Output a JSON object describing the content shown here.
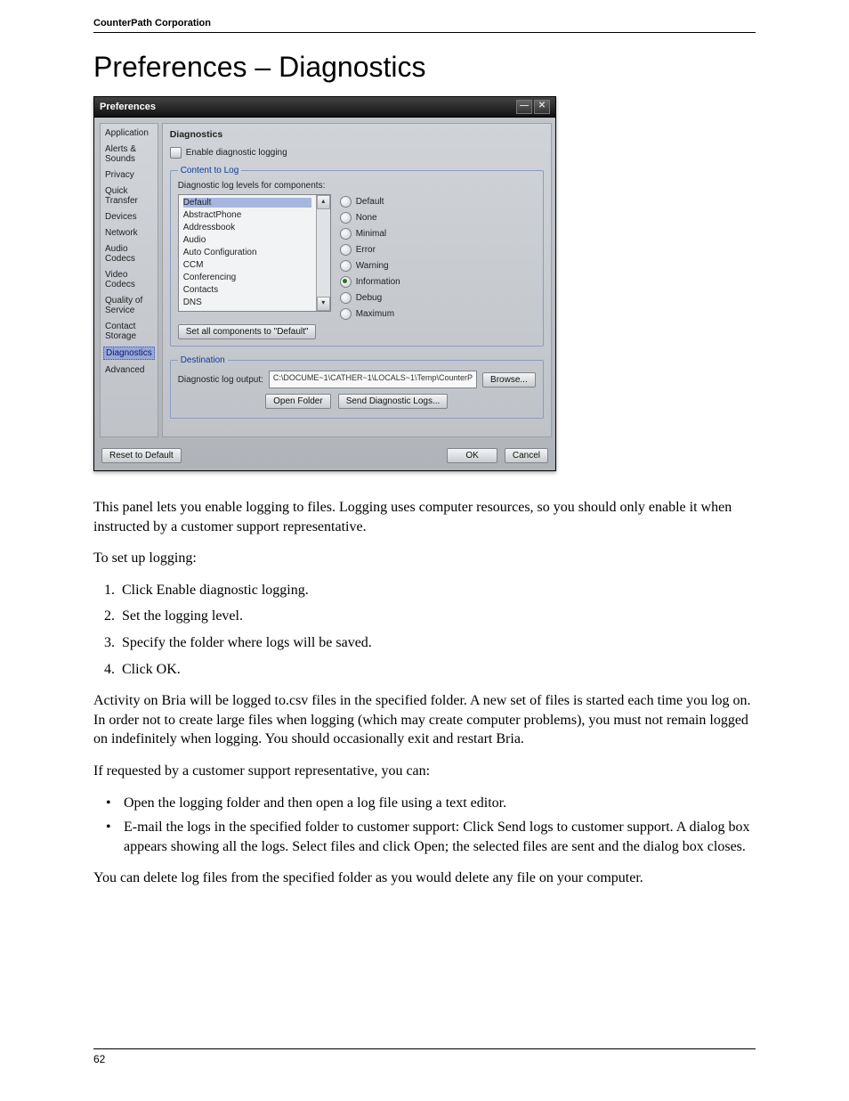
{
  "doc": {
    "header_company": "CounterPath Corporation",
    "page_title": "Preferences – Diagnostics",
    "page_number": "62"
  },
  "window": {
    "title": "Preferences",
    "sidebar": [
      "Application",
      "Alerts & Sounds",
      "Privacy",
      "Quick Transfer",
      "Devices",
      "Network",
      "Audio Codecs",
      "Video Codecs",
      "Quality of Service",
      "Contact Storage",
      "Diagnostics",
      "Advanced"
    ],
    "sidebar_selected_index": 10,
    "content_title": "Diagnostics",
    "enable_label": "Enable diagnostic logging",
    "content_legend": "Content to Log",
    "levels_label": "Diagnostic log levels for components:",
    "components": [
      "Default",
      "AbstractPhone",
      "Addressbook",
      "Audio",
      "Auto Configuration",
      "CCM",
      "Conferencing",
      "Contacts",
      "DNS"
    ],
    "component_selected_index": 0,
    "levels": [
      "Default",
      "None",
      "Minimal",
      "Error",
      "Warning",
      "Information",
      "Debug",
      "Maximum"
    ],
    "level_checked_index": 5,
    "set_all_btn": "Set all components to \"Default\"",
    "dest_legend": "Destination",
    "dest_label": "Diagnostic log output:",
    "dest_path": "C:\\DOCUME~1\\CATHER~1\\LOCALS~1\\Temp\\CounterP",
    "browse_btn": "Browse...",
    "open_folder_btn": "Open Folder",
    "send_logs_btn": "Send Diagnostic Logs...",
    "reset_btn": "Reset to Default",
    "ok_btn": "OK",
    "cancel_btn": "Cancel"
  },
  "body": {
    "para1": "This panel lets you enable logging to files. Logging uses computer resources, so you should only enable it when instructed by a customer support representative.",
    "para2": "To set up logging:",
    "steps": [
      "Click Enable diagnostic logging.",
      "Set the logging level.",
      "Specify the folder where logs will be saved.",
      "Click OK."
    ],
    "para3": "Activity on Bria will be logged to.csv files in the specified folder. A new set of files is started each time you log on. In order not to create large files when logging (which may create computer problems), you must not remain logged on indefinitely when logging. You should occasionally exit and restart Bria.",
    "para4": "If requested by a customer support representative, you can:",
    "bullets": [
      "Open the logging folder and then open a log file using a text editor.",
      "E-mail the logs in the specified folder to customer support: Click Send logs to customer support. A dialog box appears showing all the logs. Select files and click Open; the selected files are sent and the dialog box closes."
    ],
    "para5": "You can delete log files from the specified folder as you would delete any file on your computer."
  }
}
